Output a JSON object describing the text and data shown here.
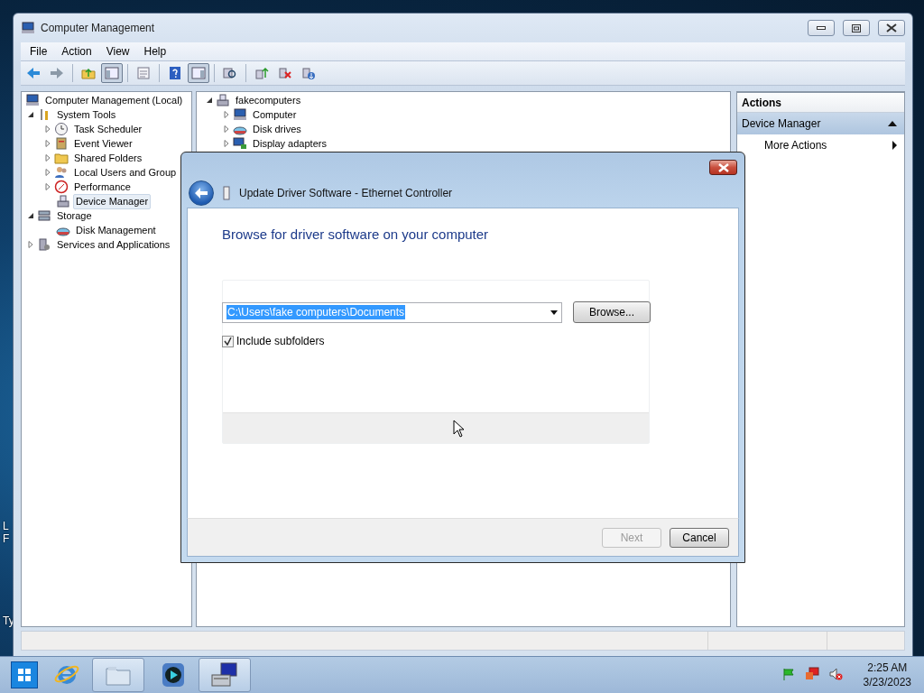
{
  "desktop_labels": [
    "L",
    "F",
    "Ty"
  ],
  "window": {
    "title": "Computer Management"
  },
  "menu": [
    "File",
    "Action",
    "View",
    "Help"
  ],
  "toolbar": [
    [
      {
        "kind": "back",
        "pressed": false
      },
      {
        "kind": "forward",
        "pressed": false
      }
    ],
    [
      {
        "kind": "up",
        "pressed": false
      },
      {
        "kind": "tree",
        "pressed": true
      }
    ],
    [
      {
        "kind": "properties",
        "pressed": false
      }
    ],
    [
      {
        "kind": "help",
        "pressed": false
      },
      {
        "kind": "pane",
        "pressed": true
      }
    ],
    [
      {
        "kind": "scan",
        "pressed": false
      }
    ],
    [
      {
        "kind": "update",
        "pressed": false
      },
      {
        "kind": "uninstall",
        "pressed": false
      },
      {
        "kind": "add",
        "pressed": false
      }
    ]
  ],
  "tree": [
    {
      "label": "Computer Management (Local)",
      "kind": "computer",
      "selected": false,
      "children": [
        {
          "label": "System Tools",
          "kind": "tools",
          "expanded": true,
          "selected": false,
          "children": [
            {
              "label": "Task Scheduler",
              "kind": "clock",
              "expanded": false,
              "selected": false
            },
            {
              "label": "Event Viewer",
              "kind": "log",
              "expanded": false,
              "selected": false
            },
            {
              "label": "Shared Folders",
              "kind": "folder",
              "expanded": false,
              "selected": false
            },
            {
              "label": "Local Users and Group",
              "kind": "users",
              "expanded": false,
              "selected": false
            },
            {
              "label": "Performance",
              "kind": "gauge",
              "expanded": false,
              "selected": false
            },
            {
              "label": "Device Manager",
              "kind": "device",
              "selected": true
            }
          ]
        },
        {
          "label": "Storage",
          "kind": "storage",
          "expanded": true,
          "selected": false,
          "children": [
            {
              "label": "Disk Management",
              "kind": "disk",
              "selected": false
            }
          ]
        },
        {
          "label": "Services and Applications",
          "kind": "services",
          "expanded": false,
          "selected": false
        }
      ]
    }
  ],
  "devices": {
    "label": "fakecomputers",
    "expanded": true,
    "children": [
      {
        "label": "Computer",
        "kind": "computer",
        "expanded": false
      },
      {
        "label": "Disk drives",
        "kind": "disk",
        "expanded": false
      },
      {
        "label": "Display adapters",
        "kind": "display",
        "expanded": false
      }
    ]
  },
  "actions": {
    "title": "Actions",
    "section": {
      "label": "Device Manager",
      "expanded": true
    },
    "items": [
      {
        "label": "More Actions"
      }
    ]
  },
  "dialog": {
    "title": "Update Driver Software - Ethernet Controller",
    "heading": "Browse for driver software on your computer",
    "path": {
      "value": "C:\\Users\\fake computers\\Documents",
      "text_selected": true
    },
    "browse": {
      "label": "Browse...",
      "disabled": false
    },
    "include_subfolders": {
      "label": "Include subfolders",
      "checked": true
    },
    "buttons": [
      {
        "label": "Next",
        "disabled": true
      },
      {
        "label": "Cancel",
        "disabled": false
      }
    ]
  },
  "taskbar": {
    "apps": [
      {
        "kind": "browser",
        "running": false
      },
      {
        "kind": "folder",
        "running": true
      },
      {
        "kind": "media",
        "running": false
      },
      {
        "kind": "management",
        "running": true
      }
    ],
    "tray": [
      {
        "kind": "flag"
      },
      {
        "kind": "network"
      },
      {
        "kind": "sound"
      }
    ],
    "clock": {
      "time": "2:25 AM",
      "date": "3/23/2023"
    }
  }
}
